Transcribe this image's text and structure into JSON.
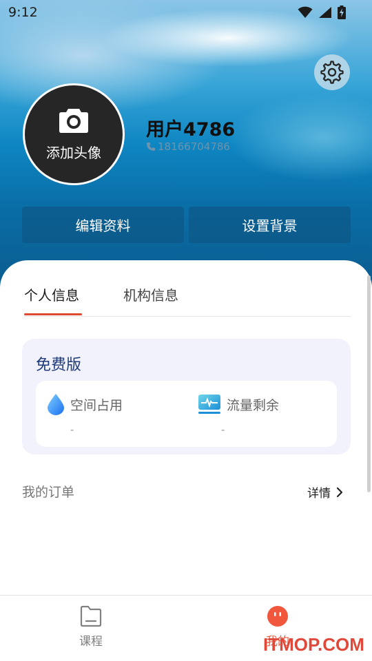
{
  "status_bar": {
    "time": "9:12",
    "icons": [
      "wifi-icon",
      "signal-icon",
      "battery-charging-icon"
    ]
  },
  "header": {
    "settings_icon": "gear-icon",
    "avatar_icon": "camera-icon",
    "avatar_label": "添加头像",
    "username": "用户4786",
    "phone_icon": "phone-icon",
    "phone": "18166704786",
    "edit_profile_button": "编辑资料",
    "set_background_button": "设置背景"
  },
  "tabs": [
    {
      "label": "个人信息",
      "active": true
    },
    {
      "label": "机构信息",
      "active": false
    }
  ],
  "plan": {
    "title": "免费版",
    "items": [
      {
        "icon": "drop-icon",
        "label": "空间占用",
        "value": "-"
      },
      {
        "icon": "traffic-icon",
        "label": "流量剩余",
        "value": "-"
      }
    ]
  },
  "orders": {
    "label": "我的订单",
    "detail_label": "详情",
    "detail_icon": "chevron-right-icon"
  },
  "bottom_nav": {
    "items": [
      {
        "label": "课程",
        "icon": "folder-icon",
        "active": false
      },
      {
        "label": "我的",
        "icon": "face-icon",
        "active": true
      }
    ]
  },
  "watermark": "ITMOP.COM",
  "colors": {
    "accent": "#e0482f",
    "plan_title": "#1f3a78",
    "card_bg": "#f1f2fc"
  }
}
